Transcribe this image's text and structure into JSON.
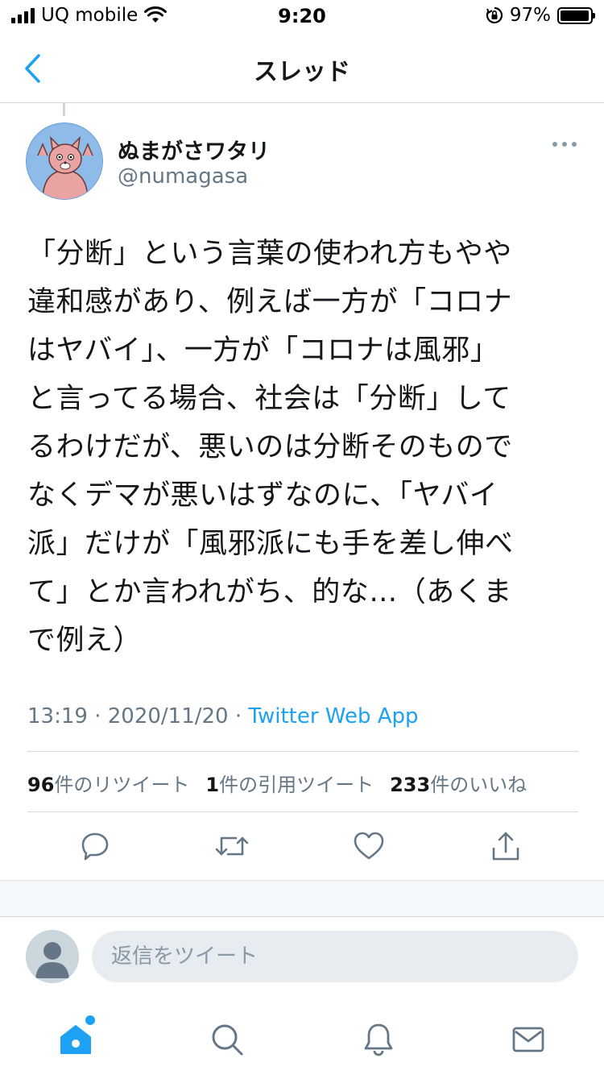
{
  "status_bar": {
    "carrier": "UQ mobile",
    "time": "9:20",
    "battery": "97%",
    "battery_level": 0.97
  },
  "nav": {
    "title": "スレッド",
    "back_icon": "chevron-left-icon"
  },
  "tweet": {
    "author_name": "ぬまがさワタリ",
    "author_handle": "@numagasa",
    "text": "「分断」という言葉の使われ方もやや\n違和感があり、例えば一方が「コロナ\nはヤバイ」、一方が「コロナは風邪」\nと言ってる場合、社会は「分断」して\nるわけだが、悪いのは分断そのもので\nなくデマが悪いはずなのに、「ヤバイ\n派」だけが「風邪派にも手を差し伸べ\nて」とか言われがち、的な…（あくま\nで例え）",
    "time": "13:19",
    "date": "2020/11/20",
    "separator": " · ",
    "source": "Twitter Web App"
  },
  "stats": {
    "retweets_count": "96",
    "retweets_label": "件のリツイート",
    "quotes_count": "1",
    "quotes_label": "件の引用ツイート",
    "likes_count": "233",
    "likes_label": "件のいいね"
  },
  "actions": [
    "reply-icon",
    "retweet-icon",
    "like-icon",
    "share-icon"
  ],
  "reply": {
    "placeholder": "返信をツイート"
  },
  "tab_bar": {
    "items": [
      "home-icon",
      "search-icon",
      "notifications-icon",
      "messages-icon"
    ],
    "active": "home-icon"
  },
  "colors": {
    "accent": "#1da1f2",
    "icon_gray": "#657786",
    "text": "#14171a"
  }
}
